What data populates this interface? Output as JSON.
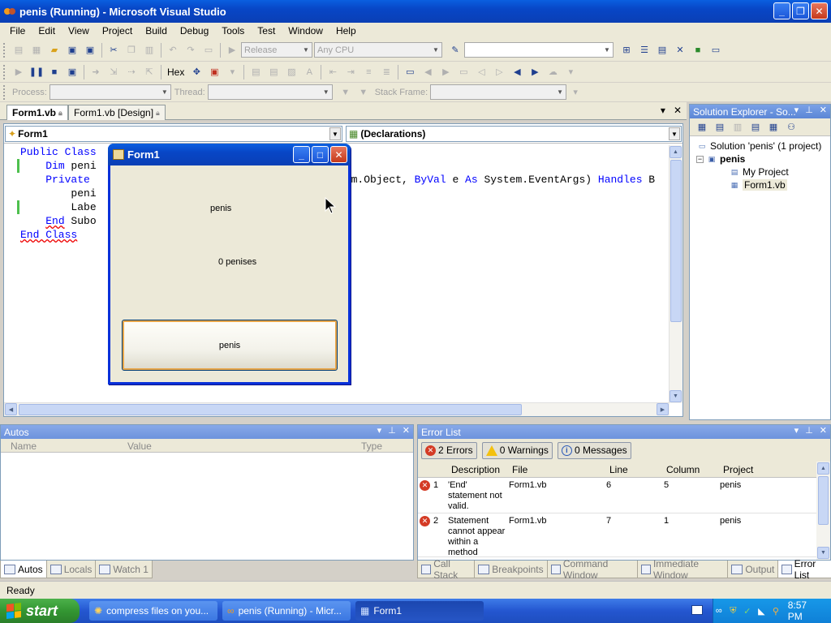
{
  "window": {
    "title": "penis (Running) - Microsoft Visual Studio",
    "minimize": "_",
    "restore": "❐",
    "close": "✕"
  },
  "menu": [
    "File",
    "Edit",
    "View",
    "Project",
    "Build",
    "Debug",
    "Tools",
    "Test",
    "Window",
    "Help"
  ],
  "toolbar": {
    "config": "Release",
    "platform": "Any CPU",
    "hex": "Hex",
    "process_label": "Process:",
    "thread_label": "Thread:",
    "stack_frame_label": "Stack Frame:"
  },
  "tabs": [
    {
      "label": "Form1.vb",
      "active": true
    },
    {
      "label": "Form1.vb [Design]",
      "active": false
    }
  ],
  "editor": {
    "class_combo": "Form1",
    "member_combo": "(Declarations)",
    "code_lines": [
      {
        "indent": "",
        "kw": "Public Class",
        "rest": ""
      },
      {
        "indent": "    ",
        "kw": "Dim",
        "rest": " peni"
      },
      {
        "indent": "    ",
        "kw": "Private",
        "rest": ""
      },
      {
        "indent": "        ",
        "kw": "",
        "rest": "peni"
      },
      {
        "indent": "        ",
        "kw": "",
        "rest": "Labe"
      },
      {
        "indent": "    ",
        "kw": "End",
        "rest": " Subo"
      },
      {
        "indent": "",
        "kw": "End Class",
        "rest": ""
      }
    ],
    "code_tail": "tem.Object, ",
    "code_tail_kw1": "ByVal",
    "code_tail_mid": " e ",
    "code_tail_kw2": "As",
    "code_tail_rest": " System.EventArgs) ",
    "code_tail_kw3": "Handles",
    "code_tail_end": " B"
  },
  "solution_explorer": {
    "title": "Solution Explorer - So...",
    "solution": "Solution 'penis' (1 project)",
    "project": "penis",
    "items": [
      "My Project",
      "Form1.vb"
    ]
  },
  "autos": {
    "title": "Autos",
    "columns": [
      "Name",
      "Value",
      "Type"
    ]
  },
  "error_list": {
    "title": "Error List",
    "errors_btn": "2 Errors",
    "warnings_btn": "0 Warnings",
    "messages_btn": "0 Messages",
    "columns": [
      "Description",
      "File",
      "Line",
      "Column",
      "Project"
    ],
    "rows": [
      {
        "num": "1",
        "desc": "'End' statement not valid.",
        "file": "Form1.vb",
        "line": "6",
        "column": "5",
        "project": "penis"
      },
      {
        "num": "2",
        "desc": "Statement cannot appear within a method",
        "file": "Form1.vb",
        "line": "7",
        "column": "1",
        "project": "penis"
      }
    ]
  },
  "bottom_left_tabs": [
    {
      "label": "Autos",
      "active": true
    },
    {
      "label": "Locals",
      "active": false
    },
    {
      "label": "Watch 1",
      "active": false
    }
  ],
  "bottom_right_tabs": [
    {
      "label": "Call Stack",
      "active": false
    },
    {
      "label": "Breakpoints",
      "active": false
    },
    {
      "label": "Command Window",
      "active": false
    },
    {
      "label": "Immediate Window",
      "active": false
    },
    {
      "label": "Output",
      "active": false
    },
    {
      "label": "Error List",
      "active": true
    }
  ],
  "status": "Ready",
  "form1": {
    "title": "Form1",
    "label1": "penis",
    "label2": "0 penises",
    "button": "penis"
  },
  "taskbar": {
    "start": "start",
    "items": [
      {
        "label": "compress files on you...",
        "active": false
      },
      {
        "label": "penis (Running) - Micr...",
        "active": false
      },
      {
        "label": "Form1",
        "active": true
      }
    ],
    "clock": "8:57 PM"
  }
}
